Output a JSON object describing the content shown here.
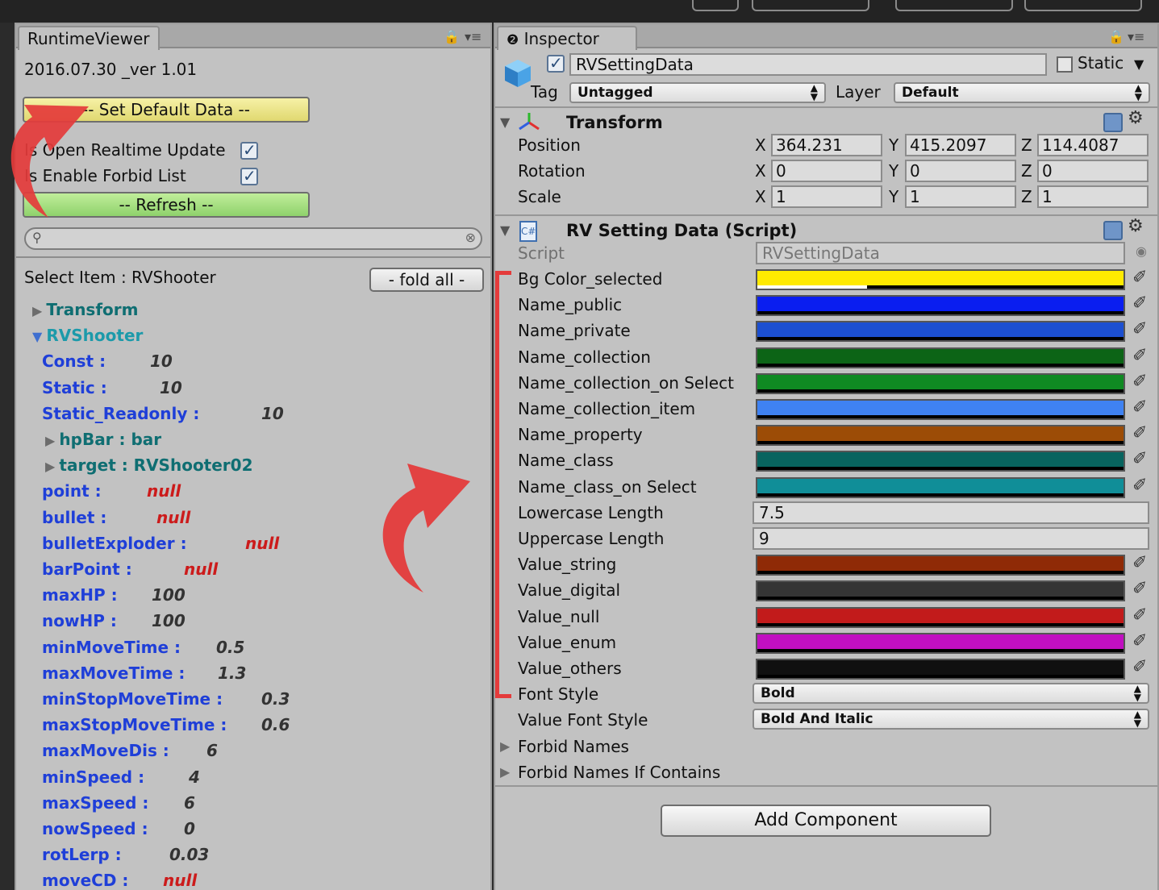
{
  "colors": {
    "panel_bg": "#c2c2c2",
    "annotation_red": "#e43b3b"
  },
  "runtime_viewer": {
    "tab_label": "RuntimeViewer",
    "version": "2016.07.30 _ver 1.01",
    "set_default_label": "-- Set Default Data --",
    "realtime_update_label": "Is Open Realtime Update",
    "realtime_update_checked": true,
    "forbid_list_label": "Is Enable Forbid List",
    "forbid_list_checked": true,
    "refresh_label": "-- Refresh --",
    "search_value": "",
    "select_item": "Select Item : RVShooter",
    "fold_all_label": "- fold all -",
    "tree": [
      {
        "label": "Transform",
        "style": "teal",
        "toggle": "collapsed"
      },
      {
        "label": "RVShooter",
        "style": "cyan",
        "toggle": "expanded"
      },
      {
        "label": "Const :",
        "value": "10",
        "value_style": "val"
      },
      {
        "label": "Static :",
        "value": "10",
        "value_style": "val"
      },
      {
        "label": "Static_Readonly :",
        "value": "10",
        "value_style": "val"
      },
      {
        "label": "hpBar : bar",
        "style": "teal",
        "toggle": "collapsed"
      },
      {
        "label": "target : RVShooter02",
        "style": "teal",
        "toggle": "collapsed"
      },
      {
        "label": "point :",
        "value": "null",
        "value_style": "null"
      },
      {
        "label": "bullet :",
        "value": "null",
        "value_style": "null"
      },
      {
        "label": "bulletExploder :",
        "value": "null",
        "value_style": "null"
      },
      {
        "label": "barPoint :",
        "value": "null",
        "value_style": "null"
      },
      {
        "label": "maxHP :",
        "value": "100",
        "value_style": "val"
      },
      {
        "label": "nowHP :",
        "value": "100",
        "value_style": "val"
      },
      {
        "label": "minMoveTime :",
        "value": "0.5",
        "value_style": "val"
      },
      {
        "label": "maxMoveTime :",
        "value": "1.3",
        "value_style": "val"
      },
      {
        "label": "minStopMoveTime :",
        "value": "0.3",
        "value_style": "val"
      },
      {
        "label": "maxStopMoveTime :",
        "value": "0.6",
        "value_style": "val"
      },
      {
        "label": "maxMoveDis :",
        "value": "6",
        "value_style": "val"
      },
      {
        "label": "minSpeed :",
        "value": "4",
        "value_style": "val"
      },
      {
        "label": "maxSpeed :",
        "value": "6",
        "value_style": "val"
      },
      {
        "label": "nowSpeed :",
        "value": "0",
        "value_style": "val"
      },
      {
        "label": "rotLerp :",
        "value": "0.03",
        "value_style": "val"
      },
      {
        "label": "moveCD :",
        "value": "null",
        "value_style": "null"
      }
    ]
  },
  "inspector": {
    "tab_label": "Inspector",
    "object_name": "RVSettingData",
    "object_active": true,
    "static_label": "Static",
    "static_checked": false,
    "tag_label": "Tag",
    "tag_value": "Untagged",
    "layer_label": "Layer",
    "layer_value": "Default",
    "transform": {
      "title": "Transform",
      "rows": [
        {
          "label": "Position",
          "x": "364.231",
          "y": "415.2097",
          "z": "114.4087"
        },
        {
          "label": "Rotation",
          "x": "0",
          "y": "0",
          "z": "0"
        },
        {
          "label": "Scale",
          "x": "1",
          "y": "1",
          "z": "1"
        }
      ],
      "axis_x": "X",
      "axis_y": "Y",
      "axis_z": "Z"
    },
    "script_component": {
      "title": "RV Setting Data (Script)",
      "script_label": "Script",
      "script_value": "RVSettingData",
      "fields": [
        {
          "label": "Bg Color_selected",
          "kind": "color",
          "color": "#ffea00",
          "alpha": 0.3
        },
        {
          "label": "Name_public",
          "kind": "color",
          "color": "#0a1ef0",
          "alpha": 1
        },
        {
          "label": "Name_private",
          "kind": "color",
          "color": "#1c4fd0",
          "alpha": 1
        },
        {
          "label": "Name_collection",
          "kind": "color",
          "color": "#0c6416",
          "alpha": 1
        },
        {
          "label": "Name_collection_on Select",
          "kind": "color",
          "color": "#0f8a22",
          "alpha": 1
        },
        {
          "label": "Name_collection_item",
          "kind": "color",
          "color": "#3f82f2",
          "alpha": 1
        },
        {
          "label": "Name_property",
          "kind": "color",
          "color": "#9c4c06",
          "alpha": 1
        },
        {
          "label": "Name_class",
          "kind": "color",
          "color": "#08645f",
          "alpha": 1
        },
        {
          "label": "Name_class_on Select",
          "kind": "color",
          "color": "#108e98",
          "alpha": 1
        },
        {
          "label": "Lowercase Length",
          "kind": "number",
          "value": "7.5"
        },
        {
          "label": "Uppercase Length",
          "kind": "number",
          "value": "9"
        },
        {
          "label": "Value_string",
          "kind": "color",
          "color": "#8f2a06",
          "alpha": 1
        },
        {
          "label": "Value_digital",
          "kind": "color",
          "color": "#353535",
          "alpha": 1
        },
        {
          "label": "Value_null",
          "kind": "color",
          "color": "#c21b1b",
          "alpha": 1
        },
        {
          "label": "Value_enum",
          "kind": "color",
          "color": "#c10fc1",
          "alpha": 1
        },
        {
          "label": "Value_others",
          "kind": "color",
          "color": "#101010",
          "alpha": 1
        },
        {
          "label": "Font Style",
          "kind": "dropdown",
          "value": "Bold"
        },
        {
          "label": "Value Font Style",
          "kind": "dropdown",
          "value": "Bold And Italic"
        },
        {
          "label": "Forbid Names",
          "kind": "foldout"
        },
        {
          "label": "Forbid Names If Contains",
          "kind": "foldout"
        }
      ]
    },
    "add_component_label": "Add Component"
  }
}
